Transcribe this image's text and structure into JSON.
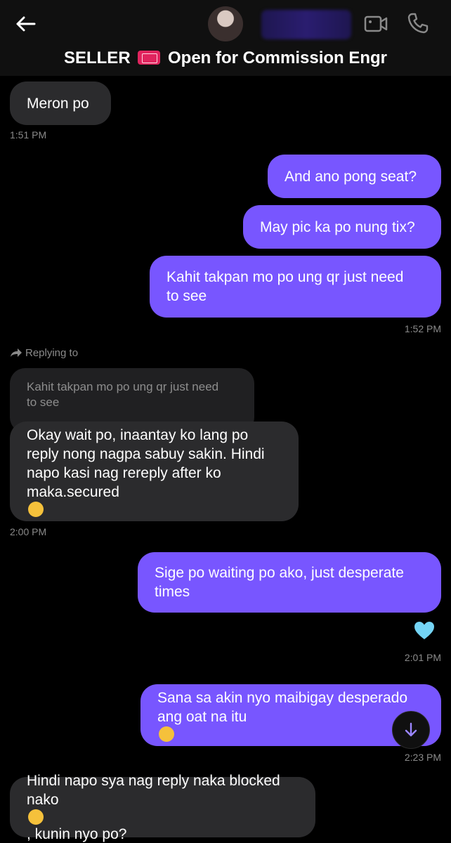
{
  "header": {
    "title_part1": "SELLER",
    "title_part2": "Open for Commission Engr",
    "back_icon": "arrow-left-icon",
    "video_icon": "video-camera-icon",
    "call_icon": "phone-icon"
  },
  "colors": {
    "background": "#000000",
    "header_bg": "#101010",
    "incoming_bubble": "#2b2b2d",
    "outgoing_bubble": "#7856ff",
    "timestamp": "#8a8a8a"
  },
  "messages": [
    {
      "dir": "in",
      "text": "Meron po"
    },
    {
      "dir": "time",
      "text": "1:51 PM"
    },
    {
      "dir": "out",
      "text": "And ano pong seat?"
    },
    {
      "dir": "out",
      "text": "May pic ka po nung tix?"
    },
    {
      "dir": "out",
      "line1": "Kahit takpan mo po ung qr just need",
      "line2": "to see"
    },
    {
      "dir": "time",
      "text": "1:52 PM"
    },
    {
      "dir": "in",
      "line1": "Okay wait po, inaantay ko lang po",
      "line2": "reply nong nagpa sabuy sakin. Hindi",
      "line3": "napo kasi nag rereply after ko",
      "line4": "maka.secured"
    },
    {
      "dir": "time",
      "text": "2:00 PM"
    },
    {
      "dir": "out",
      "line1": "Sige po waiting po ako, just desperate",
      "line2": "times"
    },
    {
      "dir": "time",
      "text": "2:01 PM"
    },
    {
      "dir": "out",
      "line1": "Sana sa akin nyo maibigay desperado",
      "line2": "ang oat na itu"
    },
    {
      "dir": "time",
      "text": "2:23 PM"
    },
    {
      "dir": "in",
      "line1": "Hindi napo sya nag reply naka blocked",
      "line2": "nako",
      "line2_after": ", kunin nyo po?"
    }
  ],
  "reply": {
    "label": "Replying to",
    "quoted_line1": "Kahit takpan mo po ung qr just need",
    "quoted_line2": "to see"
  },
  "reaction_icon": "light-blue-heart-icon",
  "scroll_icon": "arrow-down-icon"
}
